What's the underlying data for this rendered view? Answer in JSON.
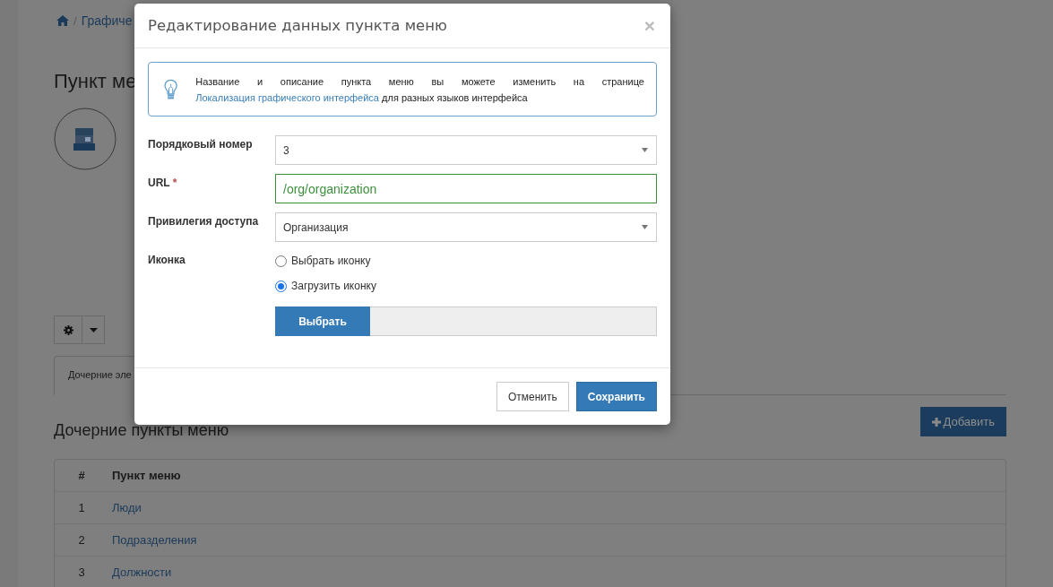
{
  "breadcrumb": {
    "separator": "/",
    "items": [
      "Графиче"
    ]
  },
  "page_title": "Пункт ме",
  "tabs": [
    {
      "label": "Дочерние эле",
      "selected": true
    }
  ],
  "section_title": "Дочерние пункты меню",
  "add_button": "Добавить",
  "table": {
    "columns": [
      "#",
      "Пункт меню"
    ],
    "rows": [
      {
        "cells": [
          "1",
          "Люди"
        ]
      },
      {
        "cells": [
          "2",
          "Подразделения"
        ]
      },
      {
        "cells": [
          "3",
          "Должности"
        ]
      }
    ]
  },
  "modal": {
    "title": "Редактирование данных пункта меню",
    "close": "×",
    "info": {
      "text_before": "Название и описание пункта меню вы можете изменить на странице ",
      "link": "Локализация графического интерфейса",
      "text_after": " для разных языков интерфейса"
    },
    "fields": [
      {
        "kind": "select",
        "label": "Порядковый номер",
        "value": "3"
      },
      {
        "kind": "text",
        "label": "URL",
        "required_mark": "*",
        "value": "/org/organization",
        "valid": true
      },
      {
        "kind": "select",
        "label": "Привилегия доступа",
        "value": "Организация"
      },
      {
        "kind": "radio",
        "label": "Иконка",
        "options": [
          {
            "label": "Выбрать иконку",
            "selected": false
          },
          {
            "label": "Загрузить иконку",
            "selected": true
          }
        ],
        "file_button": "Выбрать"
      }
    ],
    "buttons": [
      {
        "label": "Отменить",
        "kind": "default"
      },
      {
        "label": "Сохранить",
        "kind": "primary"
      }
    ]
  }
}
